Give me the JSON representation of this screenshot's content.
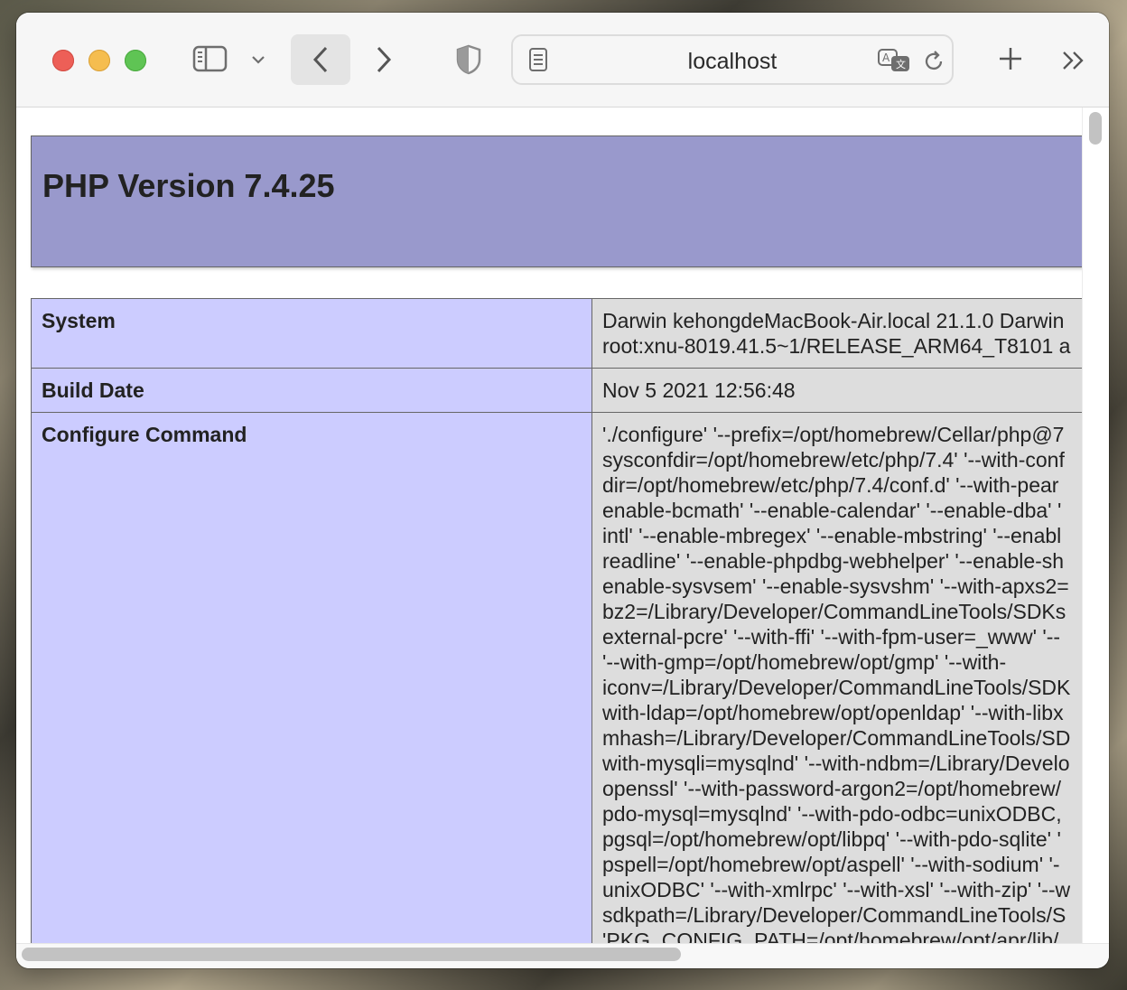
{
  "browser": {
    "address": "localhost",
    "icons": {
      "sidebar": "sidebar-icon",
      "chevron": "chevron-down-icon",
      "back": "back-arrow-icon",
      "forward": "forward-arrow-icon",
      "shield": "privacy-shield-icon",
      "reader": "reader-icon",
      "translate": "translate-icon",
      "reload": "reload-icon",
      "new_tab": "plus-icon",
      "more": "double-chevron-icon"
    }
  },
  "page": {
    "title": "PHP Version 7.4.25",
    "colors": {
      "header": "#9999cc",
      "key_cell": "#ccccff",
      "value_cell": "#dddddd"
    },
    "rows": [
      {
        "key": "System",
        "lines": [
          "Darwin kehongdeMacBook-Air.local 21.1.0 Darwin",
          "root:xnu-8019.41.5~1/RELEASE_ARM64_T8101 a"
        ]
      },
      {
        "key": "Build Date",
        "lines": [
          "Nov 5 2021 12:56:48"
        ]
      },
      {
        "key": "Configure Command",
        "lines": [
          "'./configure' '--prefix=/opt/homebrew/Cellar/php@7",
          "sysconfdir=/opt/homebrew/etc/php/7.4' '--with-conf",
          "dir=/opt/homebrew/etc/php/7.4/conf.d' '--with-pear",
          "enable-bcmath' '--enable-calendar' '--enable-dba' '",
          "intl' '--enable-mbregex' '--enable-mbstring' '--enabl",
          "readline' '--enable-phpdbg-webhelper' '--enable-sh",
          "enable-sysvsem' '--enable-sysvshm' '--with-apxs2=",
          "bz2=/Library/Developer/CommandLineTools/SDKs",
          "external-pcre' '--with-ffi' '--with-fpm-user=_www' '--",
          "'--with-gmp=/opt/homebrew/opt/gmp' '--with-",
          "iconv=/Library/Developer/CommandLineTools/SDK",
          "with-ldap=/opt/homebrew/opt/openldap' '--with-libx",
          "mhash=/Library/Developer/CommandLineTools/SD",
          "with-mysqli=mysqlnd' '--with-ndbm=/Library/Develo",
          "openssl' '--with-password-argon2=/opt/homebrew/",
          "pdo-mysql=mysqlnd' '--with-pdo-odbc=unixODBC,",
          "pgsql=/opt/homebrew/opt/libpq' '--with-pdo-sqlite' '",
          "pspell=/opt/homebrew/opt/aspell' '--with-sodium' '-",
          "unixODBC' '--with-xmlrpc' '--with-xsl' '--with-zip' '--w",
          "sdkpath=/Library/Developer/CommandLineTools/S",
          "'PKG_CONFIG_PATH=/opt/homebrew/opt/apr/lib/"
        ]
      }
    ]
  }
}
